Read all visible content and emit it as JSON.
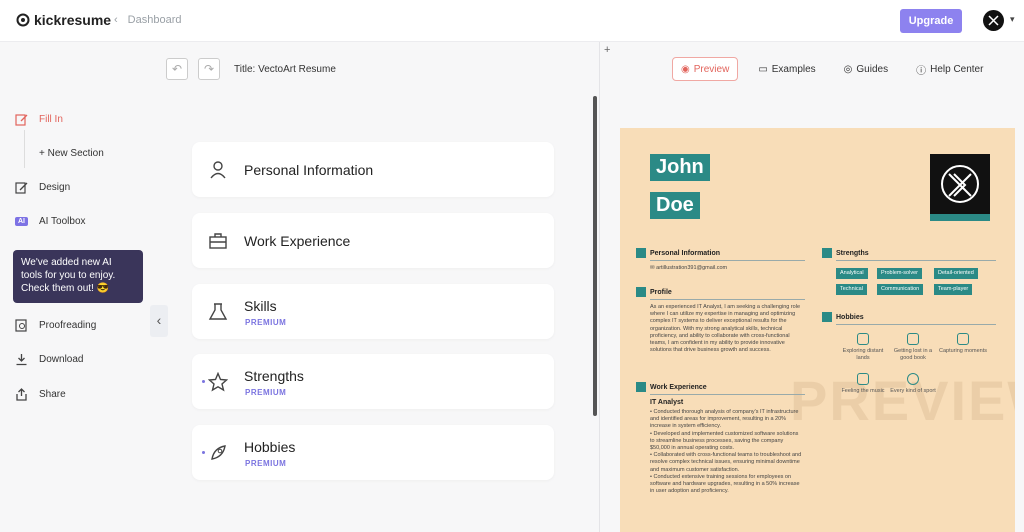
{
  "header": {
    "logo": "kickresume",
    "breadcrumb": "Dashboard",
    "upgrade": "Upgrade"
  },
  "sidebar": {
    "fill_in": "Fill In",
    "new_section": "+ New Section",
    "design": "Design",
    "ai_badge": "AI",
    "ai_toolbox": "AI Toolbox",
    "tooltip": "We've added new AI tools for you to enjoy. Check them out! 😎",
    "proofreading": "Proofreading",
    "download": "Download",
    "share": "Share"
  },
  "editor": {
    "title": "Title: VectoArt Resume",
    "sections": [
      {
        "name": "Personal Information",
        "badge": ""
      },
      {
        "name": "Work Experience",
        "badge": ""
      },
      {
        "name": "Skills",
        "badge": "PREMIUM"
      },
      {
        "name": "Strengths",
        "badge": "PREMIUM"
      },
      {
        "name": "Hobbies",
        "badge": "PREMIUM"
      }
    ]
  },
  "preview_tabs": {
    "preview": "Preview",
    "examples": "Examples",
    "guides": "Guides",
    "help": "Help Center"
  },
  "resume": {
    "first": "John",
    "last": "Doe",
    "personal_h": "Personal Information",
    "email": "artillustration391@gmail.com",
    "profile_h": "Profile",
    "profile": "As an experienced IT Analyst, I am seeking a challenging role where I can utilize my expertise in managing and optimizing complex IT systems to deliver exceptional results for the organization. With my strong analytical skills, technical proficiency, and ability to collaborate with cross-functional teams, I am confident in my ability to provide innovative solutions that drive business growth and success.",
    "work_h": "Work Experience",
    "job": "IT Analyst",
    "bullets": [
      "Conducted thorough analysis of company's IT infrastructure and identified areas for improvement, resulting in a 20% increase in system efficiency.",
      "Developed and implemented customized software solutions to streamline business processes, saving the company $50,000 in annual operating costs.",
      "Collaborated with cross-functional teams to troubleshoot and resolve complex technical issues, ensuring minimal downtime and maximum customer satisfaction.",
      "Conducted extensive training sessions for employees on software and hardware upgrades, resulting in a 50% increase in user adoption and proficiency."
    ],
    "strengths_h": "Strengths",
    "strengths": [
      "Analytical",
      "Problem-solver",
      "Detail-oriented",
      "Technical",
      "Communication",
      "Team-player"
    ],
    "hobbies_h": "Hobbies",
    "hobbies": [
      "Exploring distant lands",
      "Getting lost in a good book",
      "Capturing moments",
      "Feeling the music",
      "Every kind of sport"
    ],
    "watermark": "PREVIEW"
  }
}
